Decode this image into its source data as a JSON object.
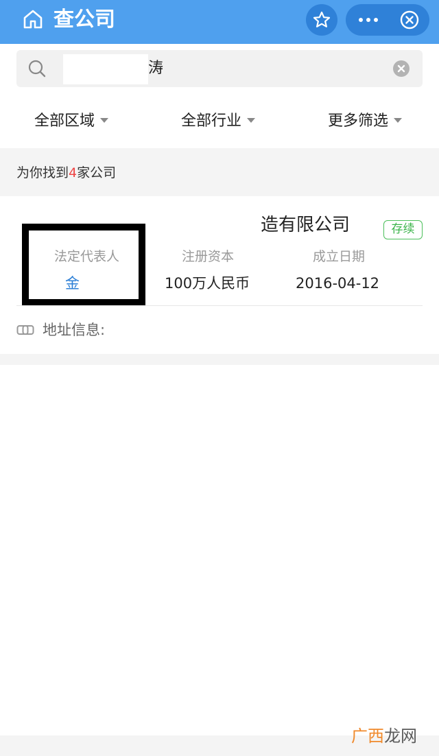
{
  "header": {
    "title": "查公司",
    "accent_color": "#4fa0ee",
    "capsule_color": "#2f81d8",
    "icons": [
      "home-icon",
      "star-icon",
      "more-icon",
      "close-circle-icon"
    ]
  },
  "search": {
    "value": "涛"
  },
  "filters": [
    {
      "label": "全部区域"
    },
    {
      "label": "全部行业"
    },
    {
      "label": "更多筛选"
    }
  ],
  "results": {
    "prefix": "为你找到",
    "count": "4",
    "suffix": "家公司",
    "highlight_color": "#e44444"
  },
  "company": {
    "name": "造有限公司",
    "status": "存续",
    "status_color": "#3cb44b",
    "legal_rep_label": "法定代表人",
    "legal_rep_value": "金",
    "capital_label": "注册资本",
    "capital_value": "100万人民币",
    "date_label": "成立日期",
    "date_value": "2016-04-12",
    "address_label": "地址信息:"
  },
  "watermark": {
    "part1": "广西",
    "part2": "龙网"
  }
}
